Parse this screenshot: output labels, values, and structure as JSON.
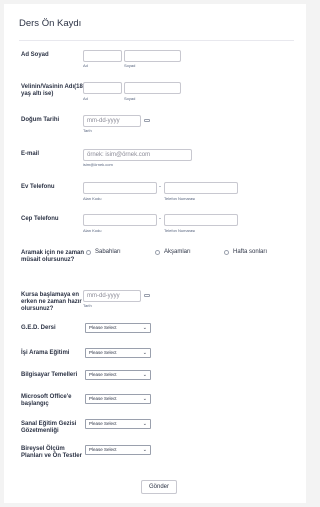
{
  "form": {
    "title": "Ders Ön Kaydı",
    "name": {
      "label": "Ad Soyad",
      "first_sub": "Ad",
      "last_sub": "Soyad"
    },
    "guardian": {
      "label": "Velinin/Vasinin Adı(18 yaş altı ise)",
      "first_sub": "Ad",
      "last_sub": "Soyad"
    },
    "birth_date": {
      "label": "Doğum Tarihi",
      "placeholder": "mm-dd-yyyy",
      "sub": "Tarih"
    },
    "email": {
      "label": "E-mail",
      "placeholder": "örnek: isim@örnek.com",
      "sub": "isim@örnek.com"
    },
    "home_phone": {
      "label": "Ev Telefonu",
      "area_sub": "Alan Kodu",
      "number_sub": "Telefon Numarası",
      "dash": "-"
    },
    "mobile_phone": {
      "label": "Cep Telefonu",
      "area_sub": "Alan Kodu",
      "number_sub": "Telefon Numarası",
      "dash": "-"
    },
    "call_time": {
      "label": "Aramak için ne zaman müsait olursunuz?",
      "options": [
        "Sabahları",
        "Akşamları",
        "Hafta sonları"
      ]
    },
    "start_date": {
      "label": "Kursa başlamaya en erken ne zaman hazır olursunuz?",
      "placeholder": "mm-dd-yyyy",
      "sub": "Tarih"
    },
    "selects": [
      {
        "label": "G.E.D. Dersi",
        "value": "Please Select"
      },
      {
        "label": "İşi Arama Eğitimi",
        "value": "Please Select"
      },
      {
        "label": "Bilgisayar Temelleri",
        "value": "Please Select"
      },
      {
        "label": "Microsoft Office'e başlangıç",
        "value": "Please Select"
      },
      {
        "label": "Sanal Eğitim Gezisi Gözetmenliği",
        "value": "Please Select"
      },
      {
        "label": "Bireysel Ölçüm Planları ve Ön Testler",
        "value": "Please Select"
      }
    ],
    "submit_label": "Gönder"
  },
  "icons": {
    "calendar": "calendar-icon",
    "chevron": "chevron-down-icon"
  },
  "colors": {
    "background": "#f3f3f3",
    "card": "#ffffff",
    "text": "#2c3345",
    "border": "#c8c8d0"
  }
}
